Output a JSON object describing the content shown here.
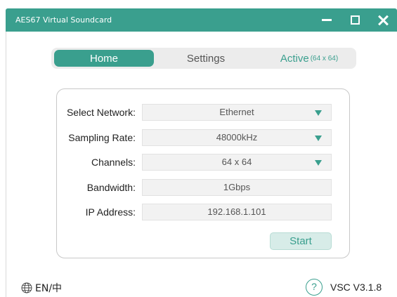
{
  "window": {
    "title": "AES67 Virtual Soundcard",
    "controls": [
      "minimize",
      "maximize",
      "close"
    ]
  },
  "tabs": {
    "home": "Home",
    "settings": "Settings",
    "active": "Active",
    "active_sub": "(64 x 64)"
  },
  "form": {
    "network_label": "Select Network:",
    "network_value": "Ethernet",
    "sampling_label": "Sampling Rate:",
    "sampling_value": "48000kHz",
    "channels_label": "Channels:",
    "channels_value": "64 x 64",
    "bandwidth_label": "Bandwidth:",
    "bandwidth_value": "1Gbps",
    "ip_label": "IP Address:",
    "ip_value": "192.168.1.101",
    "start_label": "Start"
  },
  "footer": {
    "language": "EN/中",
    "help": "?",
    "version": "VSC V3.1.8"
  },
  "colors": {
    "accent": "#3a9f8e",
    "start_bg": "#d7ece8",
    "field_bg": "#f2f2f2"
  }
}
